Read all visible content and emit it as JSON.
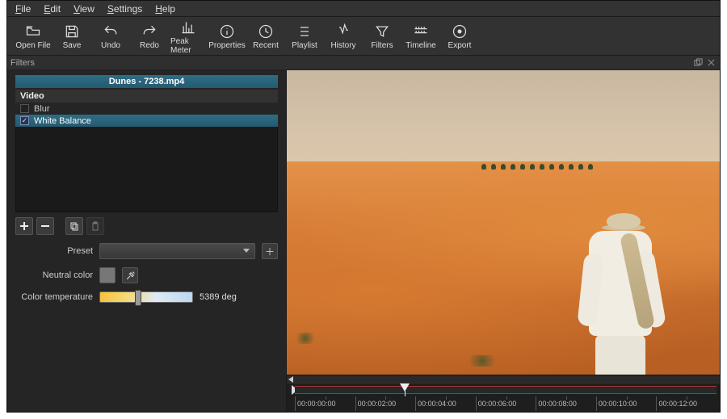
{
  "menu": {
    "items": [
      "File",
      "Edit",
      "View",
      "Settings",
      "Help"
    ]
  },
  "toolbar": [
    {
      "name": "open-file",
      "label": "Open File"
    },
    {
      "name": "save",
      "label": "Save"
    },
    {
      "name": "undo",
      "label": "Undo"
    },
    {
      "name": "redo",
      "label": "Redo"
    },
    {
      "name": "peak-meter",
      "label": "Peak Meter"
    },
    {
      "name": "properties",
      "label": "Properties"
    },
    {
      "name": "recent",
      "label": "Recent"
    },
    {
      "name": "playlist",
      "label": "Playlist"
    },
    {
      "name": "history",
      "label": "History"
    },
    {
      "name": "filters",
      "label": "Filters"
    },
    {
      "name": "timeline",
      "label": "Timeline"
    },
    {
      "name": "export",
      "label": "Export"
    }
  ],
  "panel": {
    "title": "Filters",
    "clip": "Dunes - 7238.mp4",
    "category": "Video",
    "items": [
      {
        "label": "Blur",
        "checked": false,
        "selected": false
      },
      {
        "label": "White Balance",
        "checked": true,
        "selected": true
      }
    ]
  },
  "params": {
    "preset_label": "Preset",
    "preset_value": "",
    "neutral_label": "Neutral color",
    "neutral_hex": "#808080",
    "temp_label": "Color temperature",
    "temp_value": "5389 deg",
    "temp_pos_pct": 38
  },
  "timeline": {
    "labels": [
      "00:00:00:00",
      "00:00:02:00",
      "00:00:04:00",
      "00:00:06:00",
      "00:00:08:00",
      "00:00:10:00",
      "00:00:12:00"
    ],
    "playhead_pct": 26
  }
}
